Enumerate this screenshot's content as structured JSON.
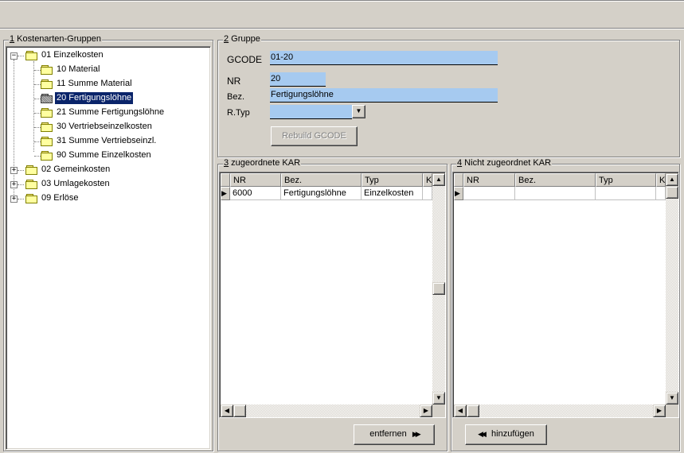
{
  "tree_group": {
    "number": "1",
    "title": " Kostenarten-Gruppen",
    "items": [
      {
        "label": "01 Einzelkosten",
        "expander": "−"
      },
      {
        "label": "10 Material"
      },
      {
        "label": "11 Summe Material"
      },
      {
        "label": "20 Fertigungslöhne"
      },
      {
        "label": "21 Summe Fertigungslöhne"
      },
      {
        "label": "30 Vertriebseinzelkosten"
      },
      {
        "label": "31 Summe Vertriebseinzl."
      },
      {
        "label": "90 Summe Einzelkosten"
      },
      {
        "label": "02 Gemeinkosten",
        "expander": "+"
      },
      {
        "label": "03 Umlagekosten",
        "expander": "+"
      },
      {
        "label": "09 Erlöse",
        "expander": "+"
      }
    ]
  },
  "gruppe": {
    "number": "2",
    "title": " Gruppe",
    "gcode_label": "GCODE",
    "gcode_value": "01-20",
    "nr_label": "NR",
    "nr_value": "20",
    "bez_label": "Bez.",
    "bez_value": "Fertigungslöhne",
    "rtyp_label": "R.Typ",
    "rtyp_value": "",
    "rebuild_label": "Rebuild GCODE"
  },
  "assigned": {
    "number": "3",
    "title": " zugeordnete KAR",
    "columns": [
      "NR",
      "Bez.",
      "Typ",
      "KE"
    ],
    "rows": [
      {
        "nr": "6000",
        "bez": "Fertigungslöhne",
        "typ": "Einzelkosten",
        "ke": ""
      }
    ],
    "remove_label": "entfernen"
  },
  "unassigned": {
    "number": "4",
    "title": " Nicht zugeordnet KAR",
    "columns": [
      "NR",
      "Bez.",
      "Typ",
      "K"
    ],
    "add_label": "hinzufügen"
  },
  "colors": {
    "field_bg": "#a6caf0",
    "selection": "#0a246a",
    "window_bg": "#d4d0c8"
  }
}
